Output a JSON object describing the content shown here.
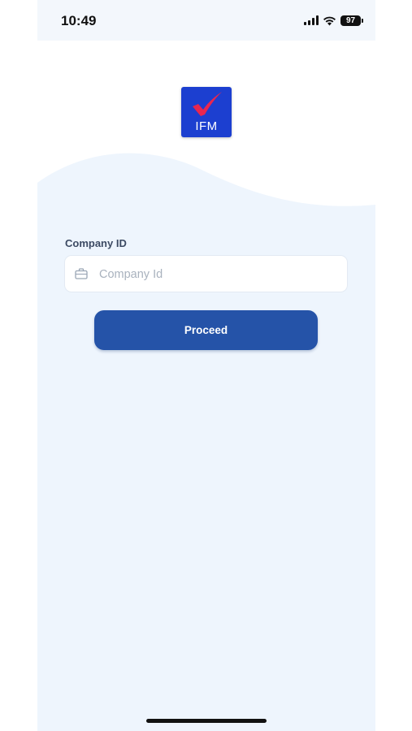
{
  "status_bar": {
    "time": "10:49",
    "battery": "97"
  },
  "logo": {
    "text": "IFM",
    "check_color": "#e8264f",
    "background": "#1c3fd0"
  },
  "form": {
    "company_label": "Company ID",
    "company_placeholder": "Company Id",
    "company_value": "",
    "proceed_label": "Proceed"
  },
  "colors": {
    "accent": "#2553a8",
    "page_background": "#eef5fd"
  }
}
